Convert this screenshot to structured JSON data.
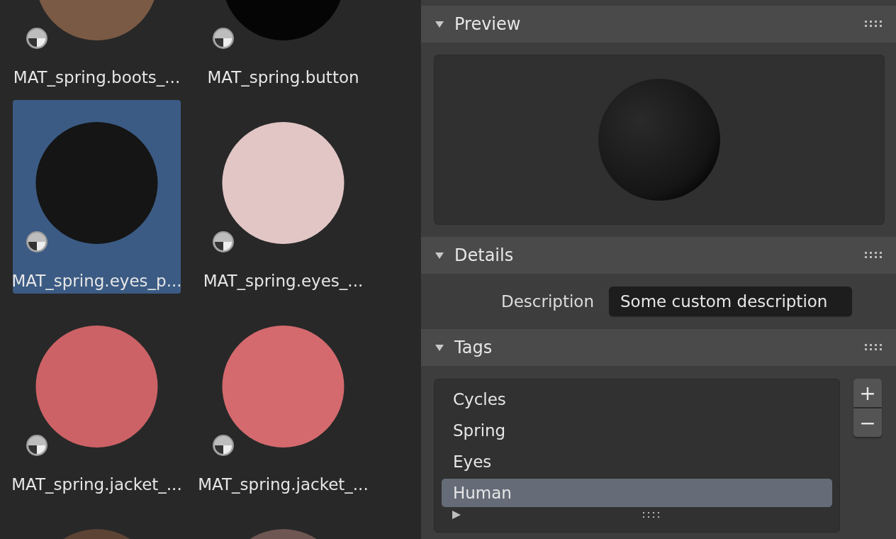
{
  "materials": [
    {
      "name": "MAT_spring.boots_...",
      "color": "#7a5a45",
      "selected": false
    },
    {
      "name": "MAT_spring.button",
      "color": "#050505",
      "selected": false
    },
    {
      "name": "MAT_spring.eyes_p...",
      "color": "#151515",
      "selected": true
    },
    {
      "name": "MAT_spring.eyes_...",
      "color": "#e2c6c6",
      "selected": false
    },
    {
      "name": "MAT_spring.jacket_...",
      "color": "#cc6266",
      "selected": false
    },
    {
      "name": "MAT_spring.jacket_...",
      "color": "#d46a6e",
      "selected": false
    },
    {
      "color": "#5c4334",
      "selected": false
    },
    {
      "color": "#6e5652",
      "selected": false
    }
  ],
  "preview": {
    "title": "Preview",
    "expanded": true
  },
  "details": {
    "title": "Details",
    "expanded": true,
    "description_label": "Description",
    "description": "Some custom description"
  },
  "tags": {
    "title": "Tags",
    "expanded": true,
    "add": "+",
    "remove": "−",
    "items": [
      {
        "name": "Cycles",
        "selected": false
      },
      {
        "name": "Spring",
        "selected": false
      },
      {
        "name": "Eyes",
        "selected": false
      },
      {
        "name": "Human",
        "selected": true
      }
    ]
  }
}
